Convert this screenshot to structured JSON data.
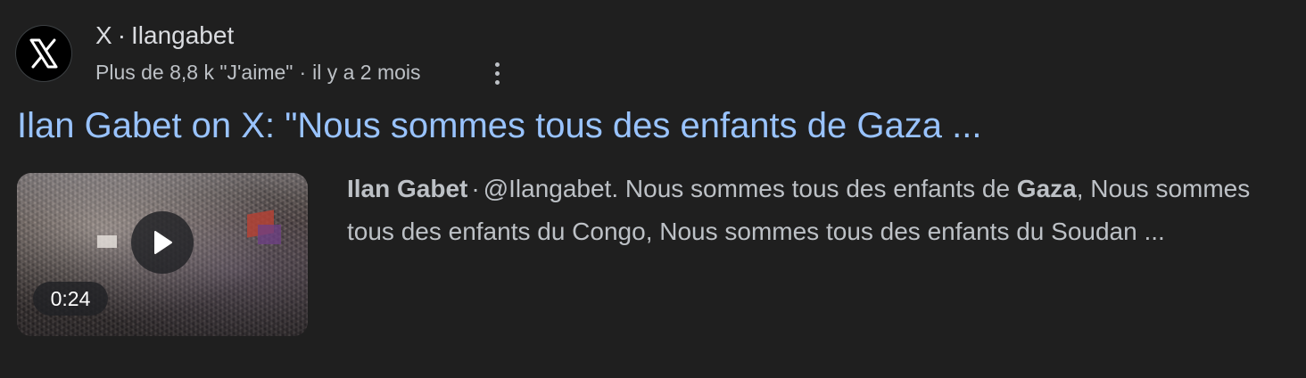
{
  "source": {
    "logo_icon": "x-logo-icon",
    "name": "X",
    "separator": "·",
    "handle": "Ilangabet"
  },
  "meta": {
    "likes": "Plus de 8,8 k \"J'aime\"",
    "separator": "·",
    "age": "il y a 2 mois",
    "more_icon": "more-vert-icon"
  },
  "title": "Ilan Gabet on X: \"Nous sommes tous des enfants de Gaza ...",
  "video": {
    "play_icon": "play-icon",
    "duration": "0:24"
  },
  "snippet": {
    "author": "Ilan Gabet",
    "separator": "·",
    "text_1": "@Ilangabet. Nous sommes tous des enfants de ",
    "highlight": "Gaza",
    "text_2": ", Nous sommes tous des enfants du Congo, Nous sommes tous des enfants du Soudan ..."
  },
  "colors": {
    "background": "#1f1f1f",
    "title_link": "#99c3ff",
    "text": "#bdc1c6"
  }
}
